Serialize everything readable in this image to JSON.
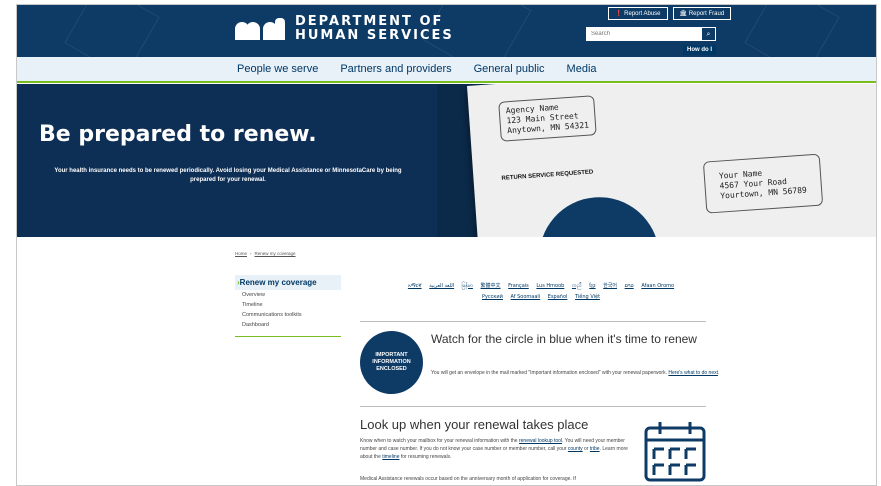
{
  "header": {
    "logo_line1": "DEPARTMENT OF",
    "logo_line2": "HUMAN SERVICES",
    "report_abuse": "Report Abuse",
    "report_fraud": "Report Fraud",
    "search_placeholder": "Search",
    "how_do_i": "How do I",
    "brand_color": "#0d3b66",
    "accent_color": "#78be20"
  },
  "nav": {
    "items": [
      "People we serve",
      "Partners and providers",
      "General public",
      "Media"
    ]
  },
  "hero": {
    "title": "Be prepared to renew.",
    "subtitle": "Your health insurance needs to be renewed periodically. Avoid losing your Medical Assistance or MinnesotaCare by being prepared for your renewal.",
    "envelope": {
      "sender": "Agency Name\n123 Main Street\nAnytown, MN 54321",
      "return_service": "RETURN SERVICE REQUESTED",
      "recipient": "Your Name\n4567 Your Road\nYourtown, MN 56789"
    }
  },
  "breadcrumb": {
    "home": "Home",
    "current": "Renew my coverage"
  },
  "sidenav": {
    "title": "Renew my coverage",
    "items": [
      "Overview",
      "Timeline",
      "Communications toolkits",
      "Dashboard"
    ]
  },
  "languages": {
    "row1": [
      "አማርኛ",
      "اللغة العربية",
      "မြန်မာ",
      "繁體中文",
      "Français",
      "Lus Hmoob",
      "ကညီ",
      "ខ្មែរ",
      "한국어",
      "ລາວ",
      "Afaan Oromo"
    ],
    "row2": [
      "Русский",
      "Af Soomaali",
      "Español",
      "Tiếng Việt"
    ]
  },
  "section1": {
    "badge": "IMPORTANT INFORMATION ENCLOSED",
    "title": "Watch for the circle in blue when it's time to renew",
    "body": "You will get an envelope in the mail marked \"Important information enclosed\" with your renewal paperwork.",
    "link": "Here's what to do next"
  },
  "section2": {
    "title": "Look up when your renewal takes place",
    "body_1": "Know when to watch your mailbox for your renewal information with the",
    "link_tool": "renewal lookup tool",
    "body_2": ". You will need your member number and case number. If you do not know your case number or member number, call your",
    "link_county": "county",
    "body_3": "or",
    "link_tribe": "tribe",
    "body_4": ". Learn more about the",
    "link_timeline": "timeline",
    "body_5": "for resuming renewals.",
    "body_extra": "Medical Assistance renewals occur based on the anniversary month of application for coverage. If"
  }
}
